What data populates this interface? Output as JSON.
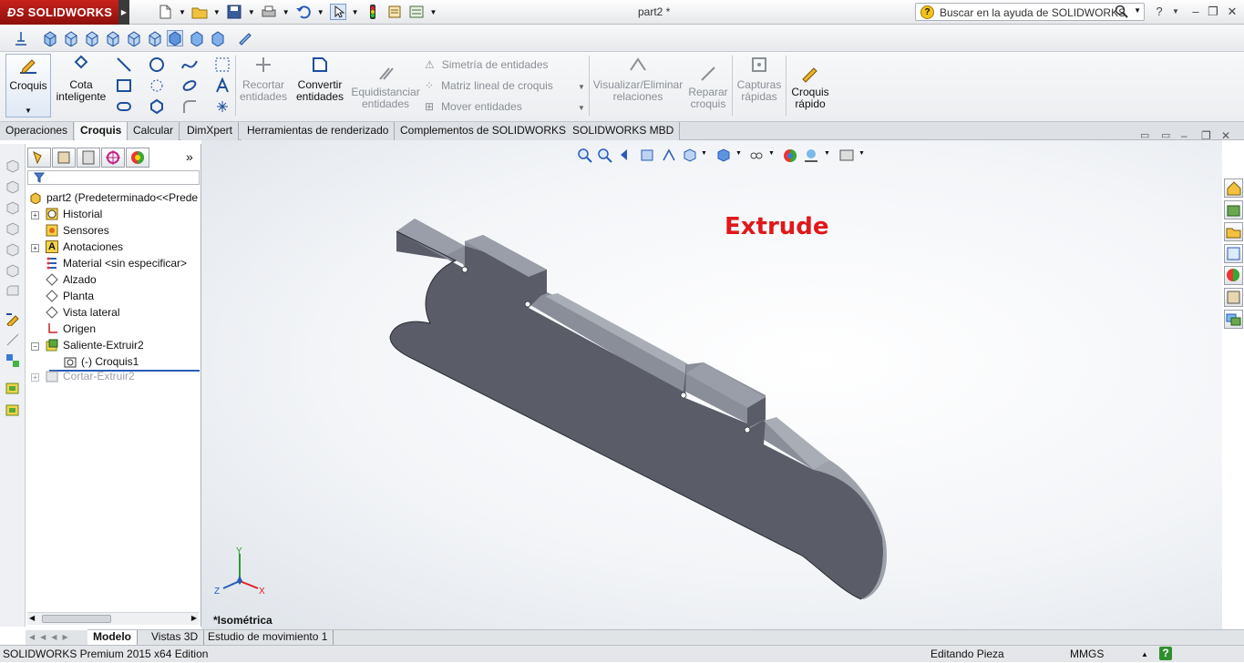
{
  "app": {
    "logo": "SOLIDWORKS",
    "document_title": "part2 *",
    "search_placeholder": "Buscar en la ayuda de SOLIDWORKS",
    "help_label": "?"
  },
  "ribbon": {
    "croquis": "Croquis",
    "cota_1": "Cota",
    "cota_2": "inteligente",
    "recortar_1": "Recortar",
    "recortar_2": "entidades",
    "convertir_1": "Convertir",
    "convertir_2": "entidades",
    "equidistanciar_1": "Equidistanciar",
    "equidistanciar_2": "entidades",
    "simetria": "Simetría de entidades",
    "matriz": "Matriz lineal de croquis",
    "mover": "Mover entidades",
    "visualizar_1": "Visualizar/Eliminar",
    "visualizar_2": "relaciones",
    "reparar_1": "Reparar",
    "reparar_2": "croquis",
    "capturas_1": "Capturas",
    "capturas_2": "rápidas",
    "rapido_1": "Croquis",
    "rapido_2": "rápido"
  },
  "tabs": [
    "Operaciones",
    "Croquis",
    "Calcular",
    "DimXpert",
    "Herramientas de renderizado",
    "Complementos de SOLIDWORKS",
    "SOLIDWORKS MBD"
  ],
  "tree": {
    "root": "part2  (Predeterminado<<Prede",
    "items": [
      "Historial",
      "Sensores",
      "Anotaciones",
      "Material <sin especificar>",
      "Alzado",
      "Planta",
      "Vista lateral",
      "Origen",
      "Saliente-Extruir2",
      "(-) Croquis1",
      "Cortar-Extruir2"
    ]
  },
  "viewport": {
    "annotation": "Extrude",
    "view_name": "*Isométrica",
    "axis_x": "X",
    "axis_y": "Y",
    "axis_z": "Z"
  },
  "bottom_tabs": [
    "Modelo",
    "Vistas 3D",
    "Estudio de movimiento 1"
  ],
  "status": {
    "edition": "SOLIDWORKS Premium 2015 x64 Edition",
    "mode": "Editando Pieza",
    "units": "MMGS",
    "help": "?"
  },
  "colors": {
    "part_face": "#5a5d68",
    "part_top": "#8a8e99",
    "part_side": "#a9adb6",
    "annotation": "#e0181b",
    "logo_bg": "#b81c17"
  }
}
